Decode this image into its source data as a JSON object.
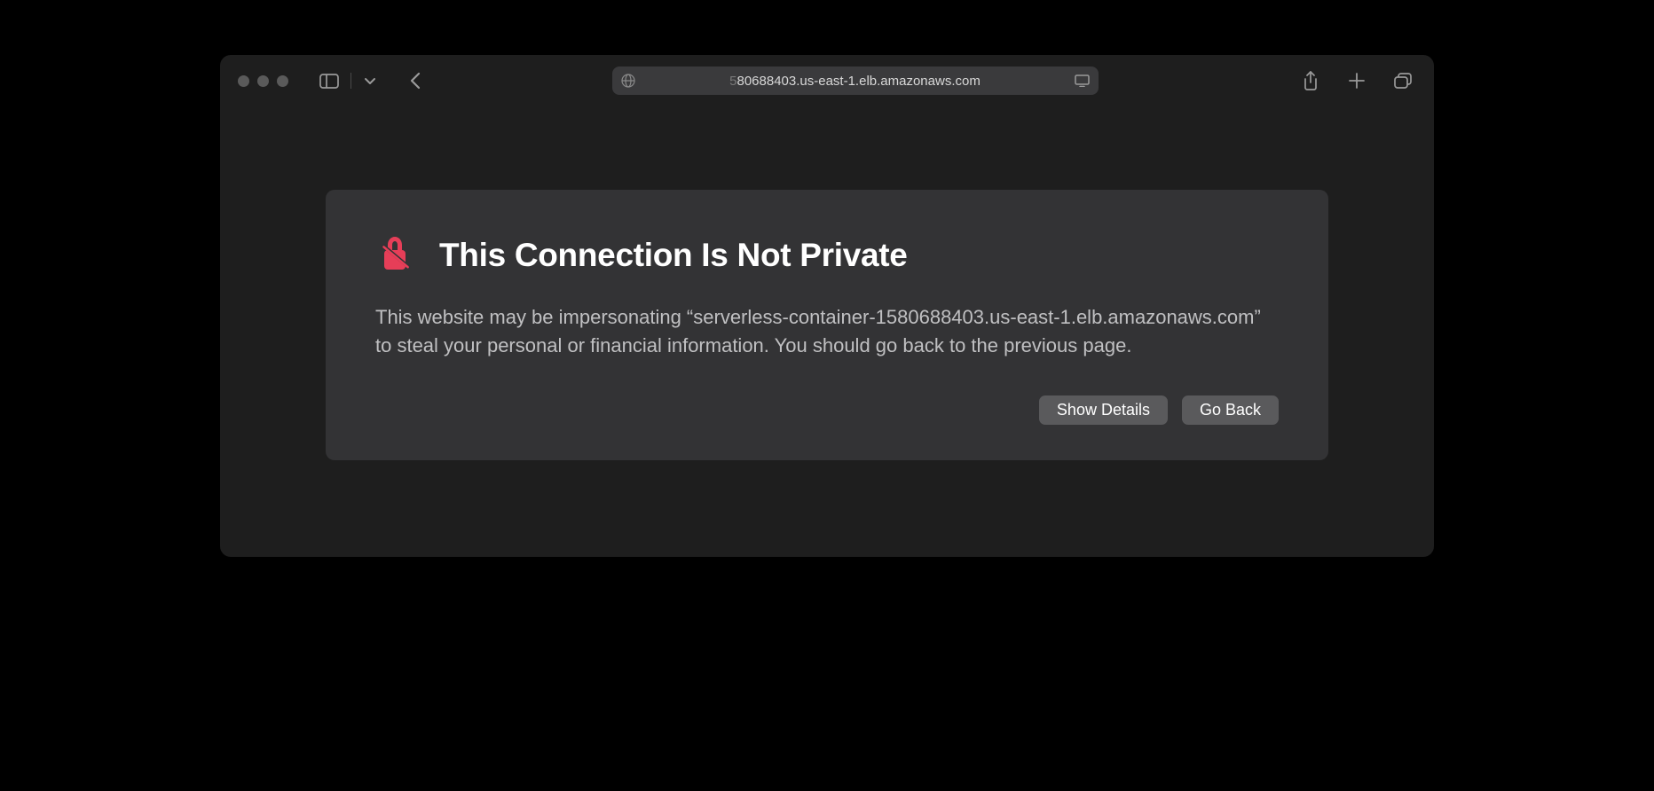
{
  "toolbar": {
    "address_faded": "5",
    "address": "80688403.us-east-1.elb.amazonaws.com"
  },
  "warning": {
    "title": "This Connection Is Not Private",
    "body": "This website may be impersonating “serverless-container-1580688403.us-east-1.elb.amazonaws.com” to steal your personal or financial information. You should go back to the previous page.",
    "show_details_label": "Show Details",
    "go_back_label": "Go Back"
  }
}
